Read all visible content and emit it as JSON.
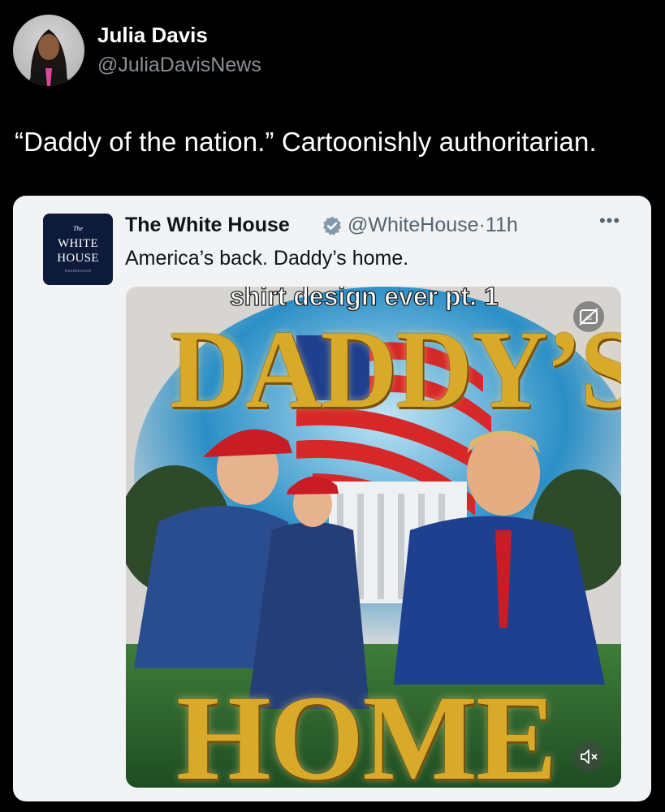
{
  "tweet": {
    "author_name": "Julia Davis",
    "author_handle": "@JuliaDavisNews",
    "text": "“Daddy of the nation.” Cartoonishly authoritarian."
  },
  "quoted_tweet": {
    "author_name": "The White House",
    "author_handle": "@WhiteHouse",
    "separator": "·",
    "time": "11h",
    "verified_color": "#829aab",
    "more_label": "•••",
    "text": "America’s back. Daddy’s home.",
    "logo": {
      "the": "The",
      "line1": "WHITE",
      "line2": "HOUSE",
      "line3": "WASHINGTON"
    },
    "media": {
      "caption": "shirt design ever pt. 1",
      "title_top": "DADDY’S",
      "title_bottom": "HOME",
      "cc_icon": "captions-off-icon",
      "mute_icon": "volume-muted-icon"
    }
  },
  "colors": {
    "background": "#000000",
    "card": "#f2f3f5",
    "gold": "#d9a92a",
    "navy": "#0e1a3a"
  }
}
